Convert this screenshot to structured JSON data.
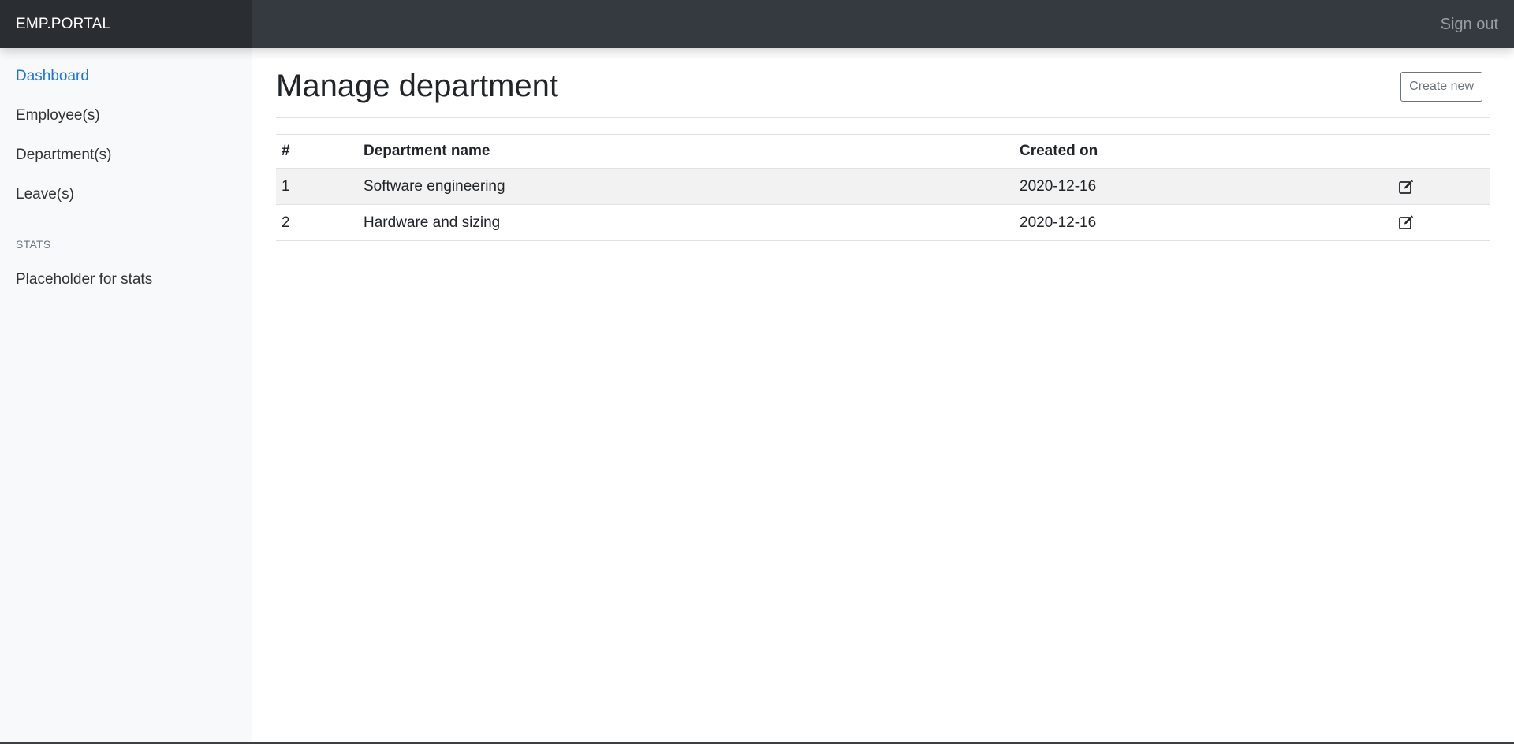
{
  "navbar": {
    "brand": "EMP.PORTAL",
    "signout_label": "Sign out"
  },
  "sidebar": {
    "items": [
      {
        "label": "Dashboard",
        "active": true
      },
      {
        "label": "Employee(s)",
        "active": false
      },
      {
        "label": "Department(s)",
        "active": false
      },
      {
        "label": "Leave(s)",
        "active": false
      }
    ],
    "stats_heading": "STATS",
    "stats_items": [
      {
        "label": "Placeholder for stats"
      }
    ]
  },
  "main": {
    "title": "Manage department",
    "create_label": "Create new",
    "table": {
      "headers": [
        "#",
        "Department name",
        "Created on",
        ""
      ],
      "rows": [
        {
          "num": "1",
          "name": "Software engineering",
          "created": "2020-12-16",
          "action_icon": "edit-icon"
        },
        {
          "num": "2",
          "name": "Hardware and sizing",
          "created": "2020-12-16",
          "action_icon": "edit-icon"
        }
      ]
    }
  },
  "colors": {
    "navbar": "#343a40",
    "brand_bg": "#2a2e33",
    "sidebar_bg": "#f8f9fa",
    "active_link": "#1a73e8",
    "striped_row": "#f2f2f2"
  }
}
